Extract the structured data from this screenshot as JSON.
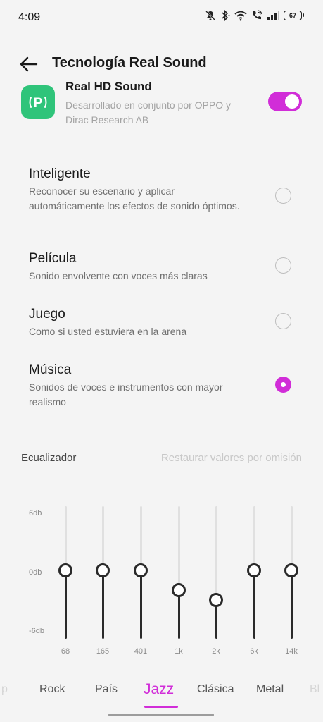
{
  "status_bar": {
    "time": "4:09",
    "battery": "67",
    "icons": [
      "mute-icon",
      "bluetooth-icon",
      "wifi-icon",
      "wifi-call-icon",
      "signal-icon",
      "battery-icon"
    ]
  },
  "header": {
    "title": "Tecnología Real Sound",
    "back_icon": "arrow-left-icon"
  },
  "real_hd": {
    "title": "Real HD Sound",
    "description": "Desarrollado en conjunto por OPPO y Dirac Research AB",
    "enabled": true,
    "icon_letter": "P"
  },
  "modes": [
    {
      "title": "Inteligente",
      "description": "Reconocer su escenario y aplicar automáticamente los efectos de sonido óptimos.",
      "selected": false
    },
    {
      "title": "Película",
      "description": "Sonido envolvente con voces más claras",
      "selected": false
    },
    {
      "title": "Juego",
      "description": "Como si usted estuviera en la arena",
      "selected": false
    },
    {
      "title": "Música",
      "description": "Sonidos de voces e instrumentos con mayor realismo",
      "selected": true
    }
  ],
  "equalizer": {
    "label": "Ecualizador",
    "reset_label": "Restaurar valores por omisión",
    "db_labels": [
      "6db",
      "0db",
      "-6db"
    ],
    "bands": [
      {
        "freq": "68",
        "gain_db": 0
      },
      {
        "freq": "165",
        "gain_db": 0
      },
      {
        "freq": "401",
        "gain_db": 0
      },
      {
        "freq": "1k",
        "gain_db": -2
      },
      {
        "freq": "2k",
        "gain_db": -3
      },
      {
        "freq": "6k",
        "gain_db": 0
      },
      {
        "freq": "14k",
        "gain_db": 0
      }
    ]
  },
  "presets": {
    "items": [
      "p",
      "Rock",
      "País",
      "Jazz",
      "Clásica",
      "Metal",
      "Bl"
    ],
    "active": "Jazz"
  },
  "colors": {
    "accent": "#d12dd8",
    "app_icon_green": "#2fc47a",
    "background": "#f4f4f4"
  }
}
